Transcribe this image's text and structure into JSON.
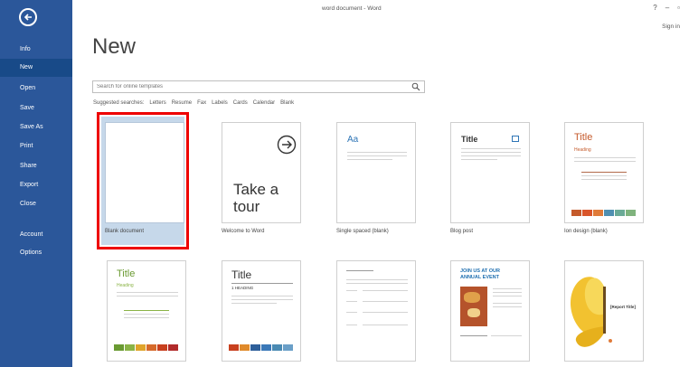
{
  "window": {
    "title": "word document - Word",
    "sign_in": "Sign in"
  },
  "sidebar": {
    "items": [
      {
        "label": "Info",
        "active": false
      },
      {
        "label": "New",
        "active": true
      },
      {
        "label": "Open",
        "active": false
      },
      {
        "label": "Save",
        "active": false
      },
      {
        "label": "Save As",
        "active": false
      },
      {
        "label": "Print",
        "active": false
      },
      {
        "label": "Share",
        "active": false
      },
      {
        "label": "Export",
        "active": false
      },
      {
        "label": "Close",
        "active": false
      },
      {
        "label": "Account",
        "active": false
      },
      {
        "label": "Options",
        "active": false
      }
    ]
  },
  "main": {
    "title": "New",
    "search": {
      "placeholder": "Search for online templates"
    },
    "suggested": {
      "label": "Suggested searches:",
      "links": [
        "Letters",
        "Resume",
        "Fax",
        "Labels",
        "Cards",
        "Calendar",
        "Blank"
      ]
    },
    "templates": [
      {
        "label": "Blank document"
      },
      {
        "label": "Welcome to Word",
        "text": "Take a tour"
      },
      {
        "label": "Single spaced (blank)",
        "text": "Aa"
      },
      {
        "label": "Blog post",
        "text": "Title"
      },
      {
        "label": "Ion design (blank)",
        "text": "Title",
        "sub": "Heading"
      },
      {
        "label": "",
        "text": "Title",
        "sub": "Heading"
      },
      {
        "label": "",
        "text": "Title",
        "sub": "1   HEADING"
      },
      {
        "label": ""
      },
      {
        "label": "",
        "text": "JOIN US AT OUR ANNUAL EVENT"
      },
      {
        "label": "",
        "text": "[Report Title]"
      }
    ]
  },
  "colors": {
    "sidebar": "#2b579a",
    "accent_red": "#e00000"
  }
}
